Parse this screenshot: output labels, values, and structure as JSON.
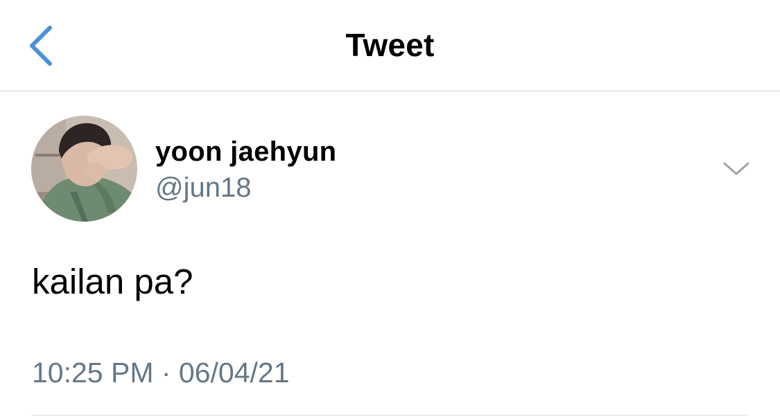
{
  "nav": {
    "title": "Tweet"
  },
  "tweet": {
    "display_name": "yoon jaehyun",
    "handle": "@jun18",
    "text": "kailan pa?",
    "timestamp": "10:25 PM · 06/04/21"
  },
  "colors": {
    "accent": "#4a90d9",
    "secondary_text": "#657786",
    "primary_text": "#000000",
    "divider": "#cfd4d8"
  },
  "icons": {
    "back": "chevron-left-icon",
    "more": "chevron-down-icon"
  }
}
